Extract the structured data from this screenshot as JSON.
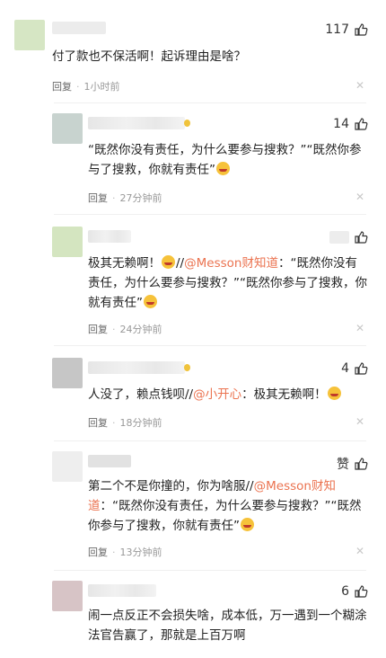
{
  "comments": [
    {
      "likes": "117",
      "text": "付了款也不保活啊！起诉理由是啥？",
      "reply": "回复",
      "time": "1小时前"
    },
    {
      "likes": "14",
      "text_a": "“既然你没有责任，为什么要参与搜救？”“既然你参与了搜救，你就有责任”",
      "reply": "回复",
      "time": "27分钟前"
    },
    {
      "likes": "",
      "text_a": "极其无赖啊！",
      "link": "@Messon财知道",
      "text_b": "：“既然你没有责任，为什么要参与搜救？”“既然你参与了搜救，你就有责任”",
      "reply": "回复",
      "time": "24分钟前"
    },
    {
      "likes": "4",
      "text_a": "人没了，赖点钱呗//",
      "link": "@小开心",
      "text_b": "：极其无赖啊！",
      "reply": "回复",
      "time": "18分钟前"
    },
    {
      "likes": "赞",
      "text_a": "第二个不是你撞的，你为啥服//",
      "link": "@Messon财知道",
      "text_b": "：“既然你没有责任，为什么要参与搜救？”“既然你参与了搜救，你就有责任”",
      "reply": "回复",
      "time": "13分钟前"
    },
    {
      "likes": "6",
      "text": "闹一点反正不会损失啥，成本低，万一遇到一个糊涂法官告赢了，那就是上百万啊"
    }
  ],
  "colors": {
    "link": "#eb7350",
    "avatars": [
      "#d6e6c4",
      "#c8d3cf",
      "#d4e5c0",
      "#c6c6c6",
      "#eeeeee",
      "#d7c4c6"
    ]
  },
  "icons": {
    "like": "thumbs-up-icon",
    "close": "close-x-icon",
    "emoji": "laughing-face-icon"
  }
}
